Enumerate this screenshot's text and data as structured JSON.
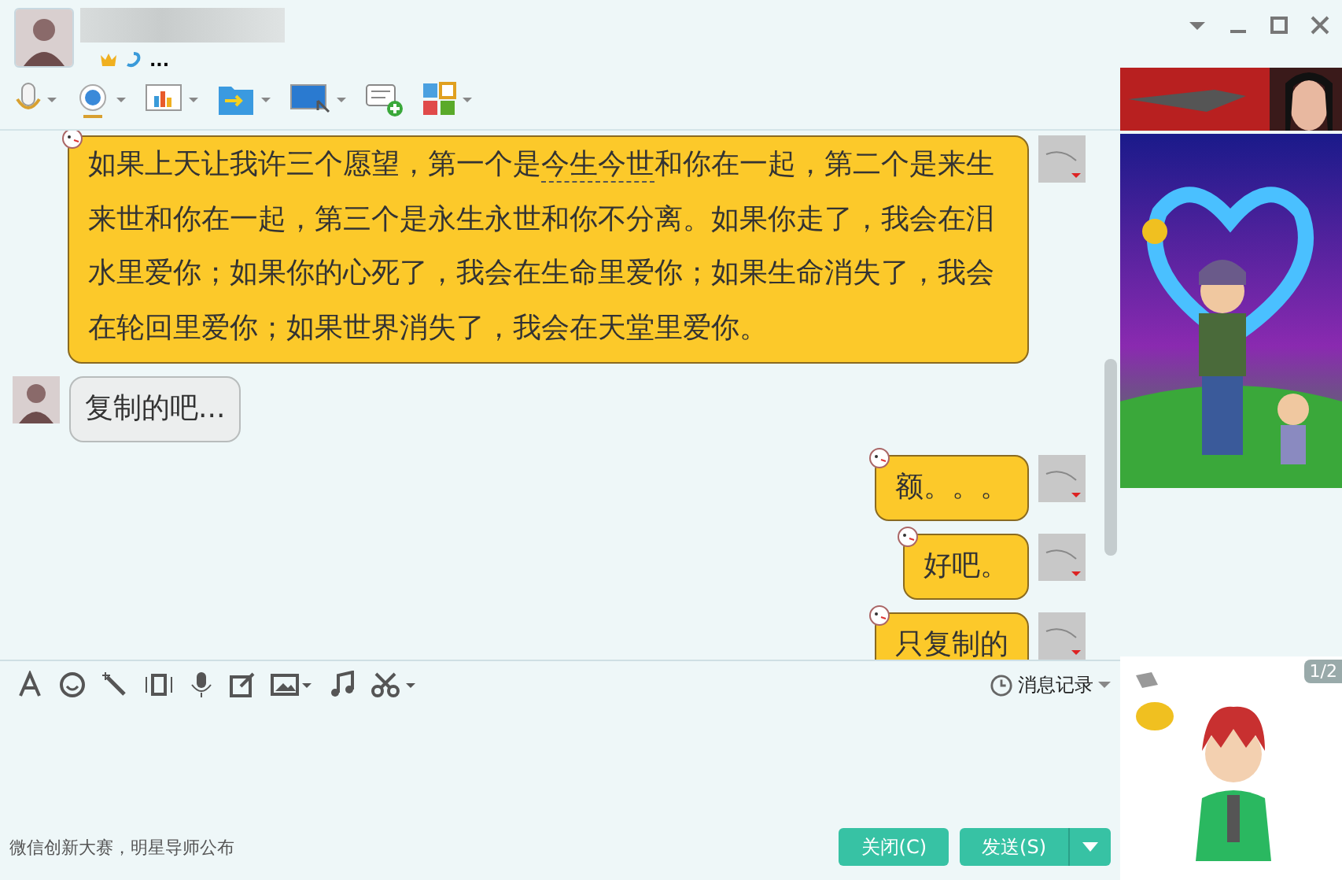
{
  "header": {
    "status_text": "..."
  },
  "messages": [
    {
      "kind": "sent",
      "segments": [
        {
          "text": "如果上天让我许三个愿望，第一个是",
          "keyword": false
        },
        {
          "text": "今生今世",
          "keyword": true
        },
        {
          "text": "和你在一起，第二个是来生来世和你在一起，第三个是永生永世和你不分离。如果你走了，我会在泪水里爱你；如果你的心死了，我会在生命里爱你；如果生命消失了，我会在轮回里爱你；如果世界消失了，我会在天堂里爱你。",
          "keyword": false
        }
      ]
    },
    {
      "kind": "received",
      "segments": [
        {
          "text": "复制的吧...",
          "keyword": false
        }
      ]
    },
    {
      "kind": "sent",
      "segments": [
        {
          "text": "额。。。",
          "keyword": false
        }
      ]
    },
    {
      "kind": "sent",
      "segments": [
        {
          "text": "好吧。",
          "keyword": false
        }
      ]
    },
    {
      "kind": "sent",
      "segments": [
        {
          "text": "只复制的",
          "keyword": false
        }
      ]
    }
  ],
  "history_button": {
    "label": "消息记录"
  },
  "footer": {
    "news": "微信创新大赛，明星导师公布",
    "buttons": [
      {
        "kind": "close",
        "label": "关闭(C)"
      },
      {
        "kind": "send",
        "label": "发送(S)"
      }
    ]
  },
  "side_panel": {
    "page": "1/2"
  }
}
